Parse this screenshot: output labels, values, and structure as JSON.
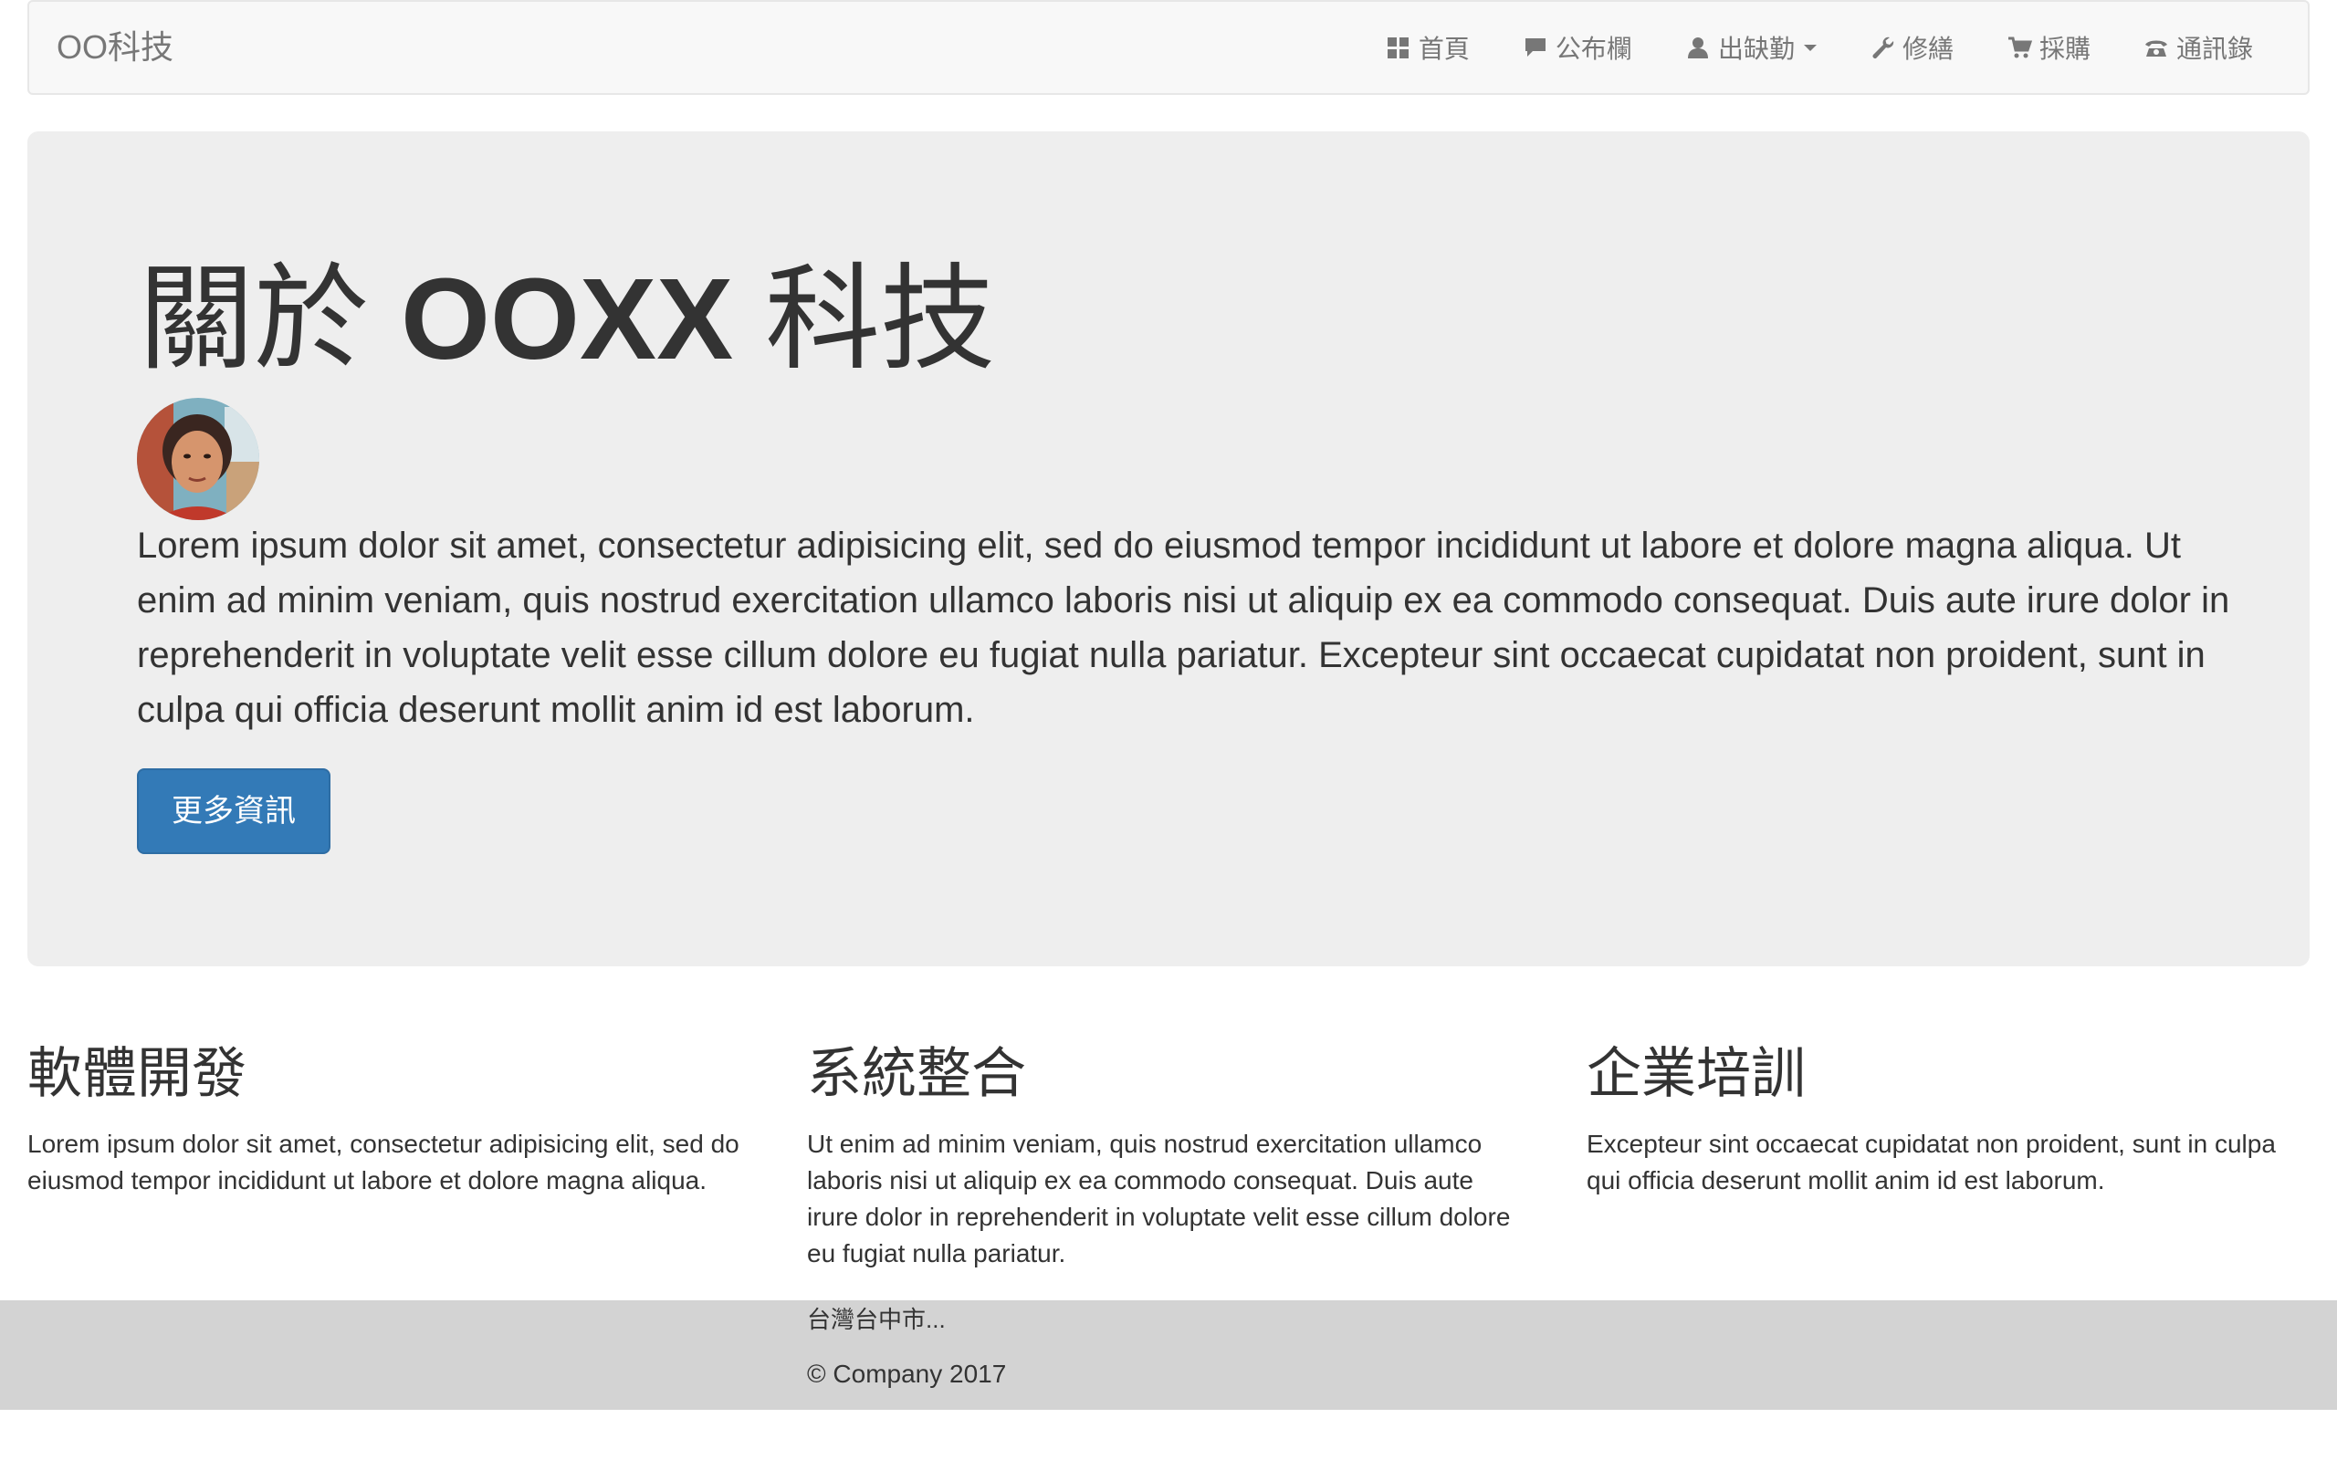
{
  "navbar": {
    "brand": "OO科技",
    "items": [
      {
        "label": "首頁",
        "icon": "th-large-icon"
      },
      {
        "label": "公布欄",
        "icon": "comment-icon"
      },
      {
        "label": "出缺勤",
        "icon": "user-icon",
        "dropdown": true
      },
      {
        "label": "修繕",
        "icon": "wrench-icon"
      },
      {
        "label": "採購",
        "icon": "shopping-cart-icon"
      },
      {
        "label": "通訊錄",
        "icon": "phone-alt-icon"
      }
    ]
  },
  "hero": {
    "title_prefix": "關於 ",
    "title_strong": "OOXX",
    "title_suffix": " 科技",
    "text": "Lorem ipsum dolor sit amet, consectetur adipisicing elit, sed do eiusmod tempor incididunt ut labore et dolore magna aliqua. Ut enim ad minim veniam, quis nostrud exercitation ullamco laboris nisi ut aliquip ex ea commodo consequat. Duis aute irure dolor in reprehenderit in voluptate velit esse cillum dolore eu fugiat nulla pariatur. Excepteur sint occaecat cupidatat non proident, sunt in culpa qui officia deserunt mollit anim id est laborum.",
    "button": "更多資訊"
  },
  "features": [
    {
      "title": "軟體開發",
      "text": "Lorem ipsum dolor sit amet, consectetur adipisicing elit, sed do eiusmod tempor incididunt ut labore et dolore magna aliqua."
    },
    {
      "title": "系統整合",
      "text": "Ut enim ad minim veniam, quis nostrud exercitation ullamco laboris nisi ut aliquip ex ea commodo consequat. Duis aute irure dolor in reprehenderit in voluptate velit esse cillum dolore eu fugiat nulla pariatur."
    },
    {
      "title": "企業培訓",
      "text": "Excepteur sint occaecat cupidatat non proident, sunt in culpa qui officia deserunt mollit anim id est laborum."
    }
  ],
  "footer": {
    "address": "台灣台中市...",
    "copyright": "© Company 2017"
  },
  "colors": {
    "navbar_bg": "#f8f8f8",
    "jumbotron_bg": "#eeeeee",
    "primary": "#337ab7",
    "footer_bg": "#d3d3d3"
  }
}
